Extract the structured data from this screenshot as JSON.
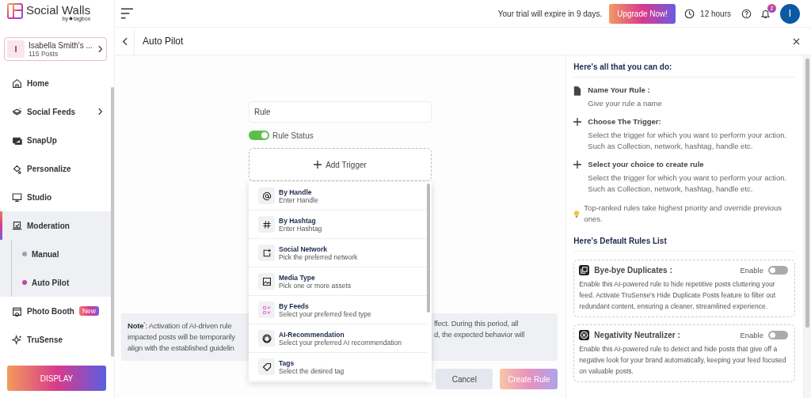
{
  "brand": {
    "name": "Social Walls",
    "by": "by",
    "maker": "tagbox"
  },
  "account": {
    "initial": "I",
    "name": "Isabella Smith's ...",
    "posts": "115 Posts"
  },
  "nav": [
    {
      "label": "Home",
      "selected": false
    },
    {
      "label": "Social Feeds",
      "selected": false,
      "submenu": true
    },
    {
      "label": "SnapUp",
      "selected": false
    },
    {
      "label": "Personalize",
      "selected": false
    },
    {
      "label": "Studio",
      "selected": false
    },
    {
      "label": "Moderation",
      "selected": true,
      "expanded": true,
      "children": [
        {
          "label": "Manual",
          "selected": false
        },
        {
          "label": "Auto Pilot",
          "selected": true
        }
      ]
    },
    {
      "label": "Photo Booth",
      "selected": false,
      "badge": "New"
    },
    {
      "label": "TruSense",
      "selected": false
    }
  ],
  "display_button": "DISPLAY",
  "topbar": {
    "trial": "Your trial will expire in 9 days.",
    "upgrade": "Upgrade Now!",
    "timer": "12 hours",
    "notifications": "2",
    "avatar": "I"
  },
  "page": {
    "title": "Auto Pilot"
  },
  "form": {
    "rule_name": {
      "value": "Rule"
    },
    "rule_status": {
      "label": "Rule Status",
      "on": true
    },
    "add_trigger": "Add Trigger",
    "triggers": [
      {
        "title": "By Handle",
        "subtitle": "Enter Handle"
      },
      {
        "title": "By Hashtag",
        "subtitle": "Enter Hashtag"
      },
      {
        "title": "Social Network",
        "subtitle": "Pick the preferred network"
      },
      {
        "title": "Media Type",
        "subtitle": "Pick one or more assets"
      },
      {
        "title": "By Feeds",
        "subtitle": "Select your preferred feed type"
      },
      {
        "title": "AI-Recommendation",
        "subtitle": "Select your preferred AI recommendation"
      },
      {
        "title": "Tags",
        "subtitle": "Select the desired tag"
      }
    ],
    "cancel": "Cancel",
    "create": {
      "label": "Create Rule",
      "disabled": true
    }
  },
  "note": {
    "left_lines": [
      "**Note**$^{*}$: Activation of AI-driven rule",
      "impacted posts will be temporarily",
      "align with the established guidelin"
    ],
    "right_lines": [
      "ffect. During this period, all",
      "d, the expected behavior will"
    ]
  },
  "help": {
    "title": "Here's all that you can do:",
    "steps": [
      {
        "title": "Name Your Rule :",
        "text": "Give your rule a name"
      },
      {
        "title": "Choose The Trigger:",
        "text": "Select the trigger for which you want to perform your action. Such as Collection, network, hashtag, handle etc."
      },
      {
        "title": "Select your choice to create rule",
        "text": "Select the trigger for which you want to perform your action. Such as Collection, network, hashtag, handle etc."
      }
    ],
    "tip": "Top-ranked rules take highest priority and override previous ones.",
    "defaults_title": "Here's Default Rules List",
    "rules": [
      {
        "title": "Bye-bye Duplicates :",
        "toggle_label": "Enable",
        "enabled": false,
        "text": "Enable this AI-powered rule to hide repetitive posts cluttering your feed. Activate TruSense's Hide Duplicate Posts feature to filter out redundant content, ensuring a cleaner, streamlined experience."
      },
      {
        "title": "Negativity Neutralizer :",
        "toggle_label": "Enable",
        "enabled": false,
        "text": "Enable this AI-powered rule to detect and hide posts that give off a negative look for your brand automatically, keeping your feed focused on valuable posts."
      }
    ]
  }
}
